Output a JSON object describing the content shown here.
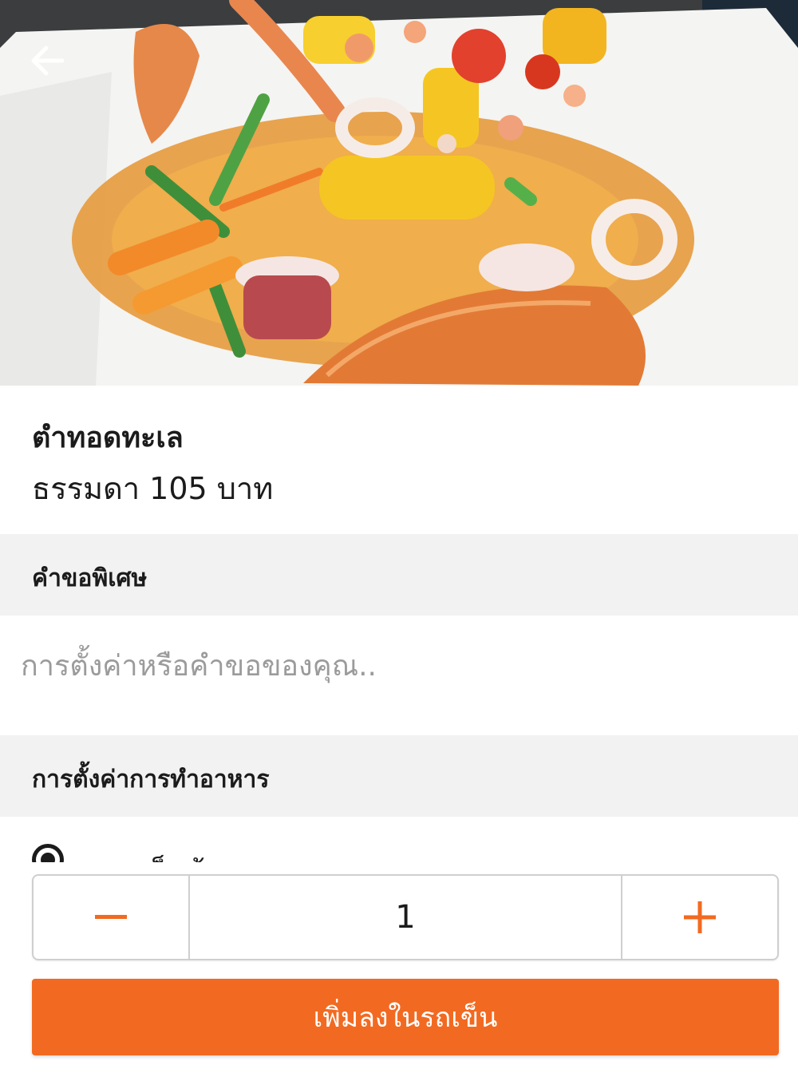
{
  "dish": {
    "name": "ตำทอดทะเล",
    "price_line": "ธรรมดา 105 บาท"
  },
  "special_request": {
    "header": "คำขอพิเศษ",
    "placeholder": "การตั้งค่าหรือคำขอของคุณ.."
  },
  "cooking_settings": {
    "header": "การตั้งค่าการทำอาหาร",
    "options": [
      {
        "label": "เผ็ดน้อย",
        "selected": true
      }
    ]
  },
  "quantity": {
    "value": "1"
  },
  "actions": {
    "add_to_cart": "เพิ่มลงในรถเข็น"
  },
  "colors": {
    "accent": "#f26a21",
    "section_bg": "#f2f2f2",
    "placeholder": "#9b9b9b"
  },
  "icons": {
    "back": "arrow-left-icon",
    "minus": "minus-icon",
    "plus": "plus-icon"
  }
}
